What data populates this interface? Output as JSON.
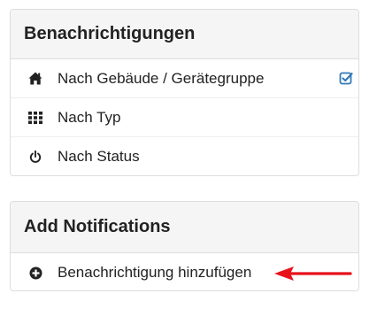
{
  "notifications_panel": {
    "title": "Benachrichtigungen",
    "items": [
      {
        "label": "Nach Gebäude / Gerätegruppe",
        "icon": "home-icon",
        "checked": true
      },
      {
        "label": "Nach Typ",
        "icon": "grid-icon"
      },
      {
        "label": "Nach Status",
        "icon": "power-icon"
      }
    ]
  },
  "add_panel": {
    "title": "Add Notifications",
    "items": [
      {
        "label": "Benachrichtigung hinzufügen",
        "icon": "plus-circle-icon"
      }
    ]
  },
  "colors": {
    "accent": "#337ab7",
    "annotation_arrow": "#e8121a",
    "panel_heading_bg": "#f5f5f5",
    "panel_border": "#dddddd"
  }
}
